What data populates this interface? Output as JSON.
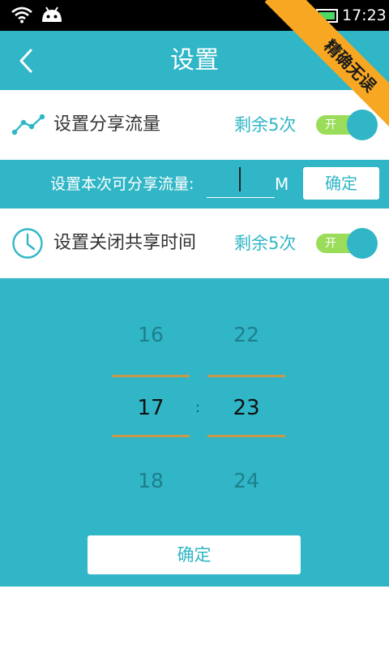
{
  "status_bar": {
    "time": "17:23",
    "icons": [
      "wifi-icon",
      "android-icon",
      "battery-icon"
    ]
  },
  "header": {
    "title": "设置",
    "back_icon": "chevron-left-icon"
  },
  "flow_setting": {
    "title": "设置分享流量",
    "remaining": "剩余5次",
    "toggle_label": "开",
    "toggle_on": true,
    "icon": "trend-line-icon"
  },
  "flow_input": {
    "label": "设置本次可分享流量:",
    "value": "",
    "unit": "M",
    "confirm_label": "确定"
  },
  "close_time_setting": {
    "title": "设置关闭共享时间",
    "remaining": "剩余5次",
    "toggle_label": "开",
    "toggle_on": true,
    "icon": "clock-icon"
  },
  "time_picker": {
    "hours": {
      "prev": "16",
      "current": "17",
      "next": "18"
    },
    "separator": ":",
    "minutes": {
      "prev": "22",
      "current": "23",
      "next": "24"
    },
    "confirm_label": "确定"
  },
  "ribbon": {
    "text": "精确无误"
  },
  "colors": {
    "accent": "#30b6c6",
    "toggle_track": "#9bdc5a",
    "selection_line": "#c69a4a",
    "ribbon": "#f7a722",
    "battery": "#4cd964"
  }
}
